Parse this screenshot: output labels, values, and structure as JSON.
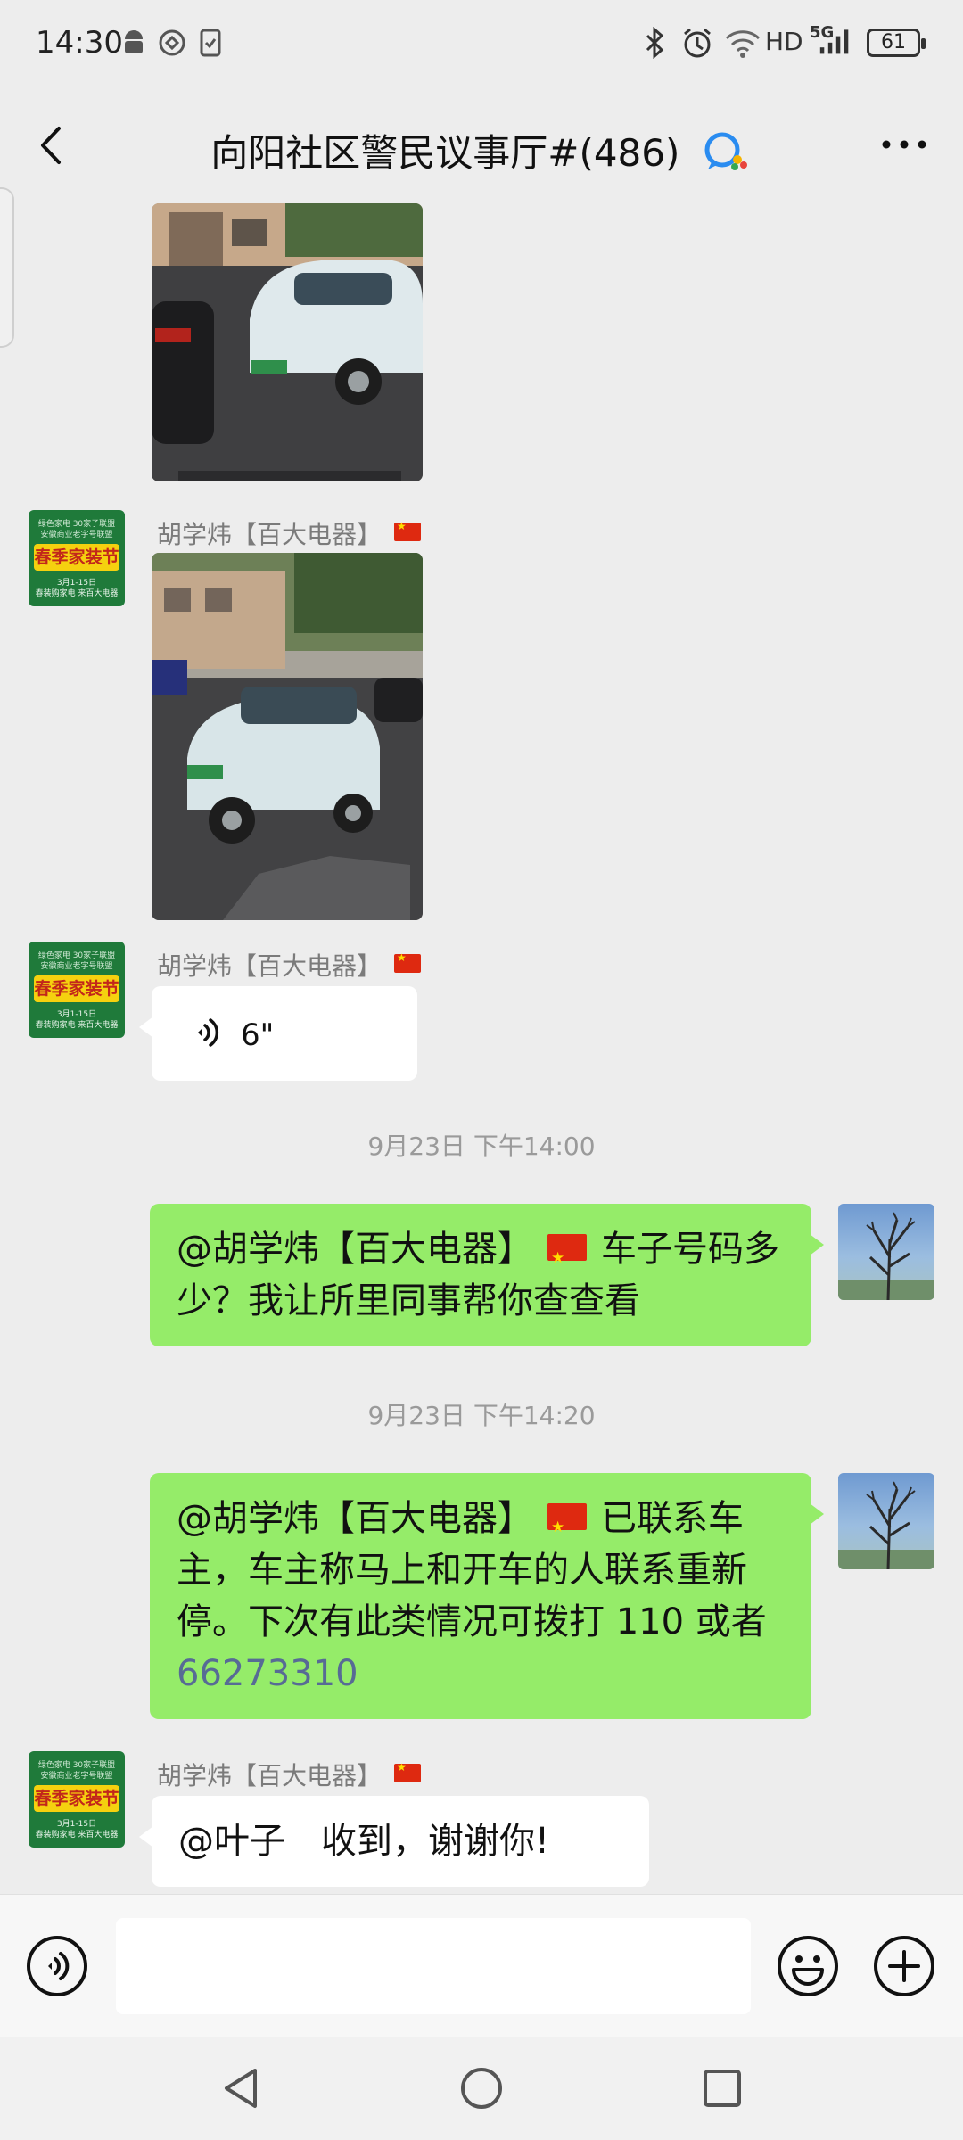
{
  "status_bar": {
    "time": "14:30",
    "network": "HD",
    "network_gen": "5G",
    "battery": "61",
    "icons": [
      "android-icon",
      "vpn-icon",
      "sim-icon",
      "bluetooth-icon",
      "alarm-icon",
      "wifi-icon",
      "signal-icon",
      "battery-icon"
    ]
  },
  "nav": {
    "title": "向阳社区警民议事厅#(486)",
    "back_icon": "back-arrow-icon",
    "more_icon": "more-icon"
  },
  "messages": [
    {
      "type": "image",
      "side": "left",
      "subject": "white electric car parked (continuation)"
    },
    {
      "type": "image",
      "side": "left",
      "sender": "胡学炜【百大电器】",
      "subject": "white electric car"
    },
    {
      "type": "voice",
      "side": "left",
      "sender": "胡学炜【百大电器】",
      "duration": "6\""
    },
    {
      "type": "timestamp",
      "text": "9月23日 下午14:00"
    },
    {
      "type": "text",
      "side": "right",
      "mention": "@胡学炜【百大电器】",
      "text": "车子号码多少？我让所里同事帮你查查看"
    },
    {
      "type": "timestamp",
      "text": "9月23日 下午14:20"
    },
    {
      "type": "text",
      "side": "right",
      "mention": "@胡学炜【百大电器】",
      "text": "已联系车主，车主称马上和开车的人联系重新停。下次有此类情况可拨打 110 或者",
      "phone": "66273310"
    },
    {
      "type": "text",
      "side": "left",
      "sender": "胡学炜【百大电器】",
      "text": "@叶子　收到，谢谢你!"
    }
  ],
  "avatar_ad": {
    "top_line1": "绿色家电 30家子联盟",
    "top_line2": "安徽商业老字号联盟",
    "headline": "春季家装节",
    "date": "3月1-15日",
    "footer": "春装购家电 来百大电器"
  },
  "input_bar": {
    "voice_icon": "voice-toggle-icon",
    "emoji_icon": "emoji-icon",
    "plus_icon": "plus-icon"
  },
  "system_nav": [
    "back-triangle-icon",
    "home-circle-icon",
    "recents-square-icon"
  ],
  "colors": {
    "background": "#ededed",
    "bubble_right": "#95ec69",
    "bubble_left": "#ffffff",
    "link": "#576b95"
  }
}
